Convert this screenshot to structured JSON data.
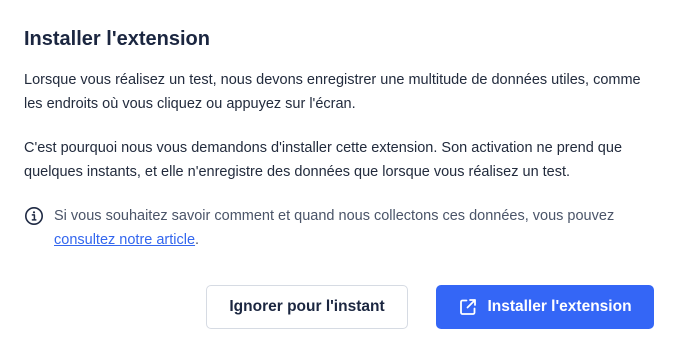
{
  "dialog": {
    "title": "Installer l'extension",
    "paragraph_1": "Lorsque vous réalisez un test, nous devons enregistrer une multitude de données utiles, comme les endroits où vous cliquez ou appuyez sur l'écran.",
    "paragraph_2": "C'est pourquoi nous vous demandons d'installer cette extension. Son activation ne prend que quelques instants, et elle n'enregistre des données que lorsque vous réalisez un test.",
    "info": {
      "icon": "info-circle-icon",
      "text": "Si vous souhaitez savoir comment et quand nous collectons ces données, vous pouvez ",
      "link_text": "consultez notre article",
      "suffix": "."
    },
    "buttons": {
      "ignore_label": "Ignorer pour l'instant",
      "install_label": "Installer l'extension",
      "install_icon": "external-link-icon"
    }
  },
  "colors": {
    "primary": "#3466f6",
    "link": "#3366ee",
    "title": "#1b2640",
    "muted_text": "#4a5468"
  }
}
